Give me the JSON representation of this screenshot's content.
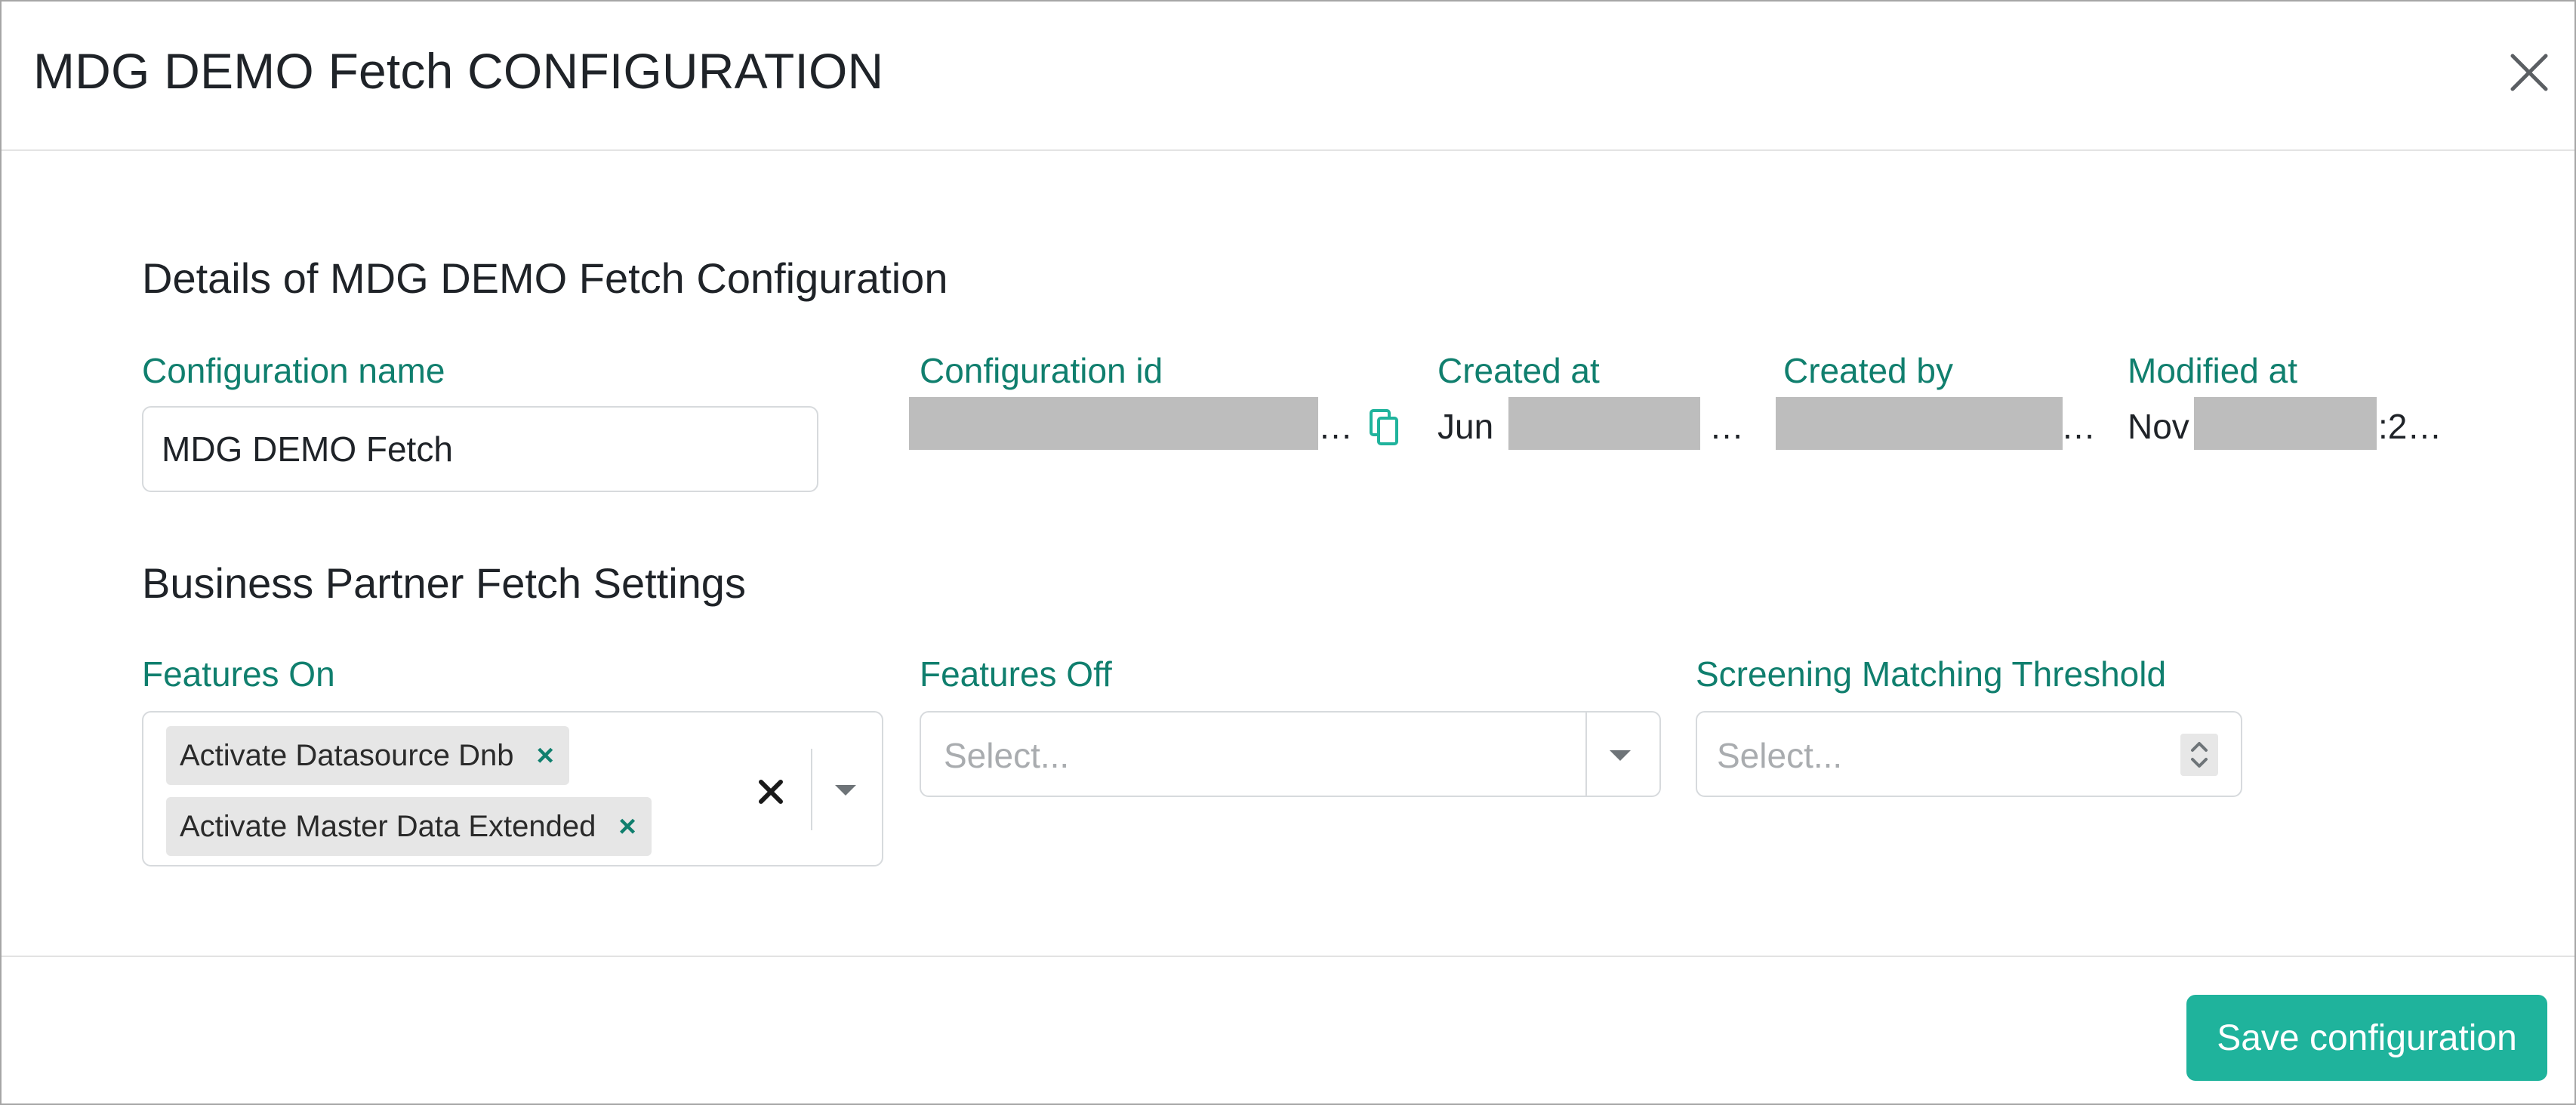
{
  "dialog": {
    "title": "MDG DEMO Fetch CONFIGURATION",
    "close_icon": "close-icon"
  },
  "details": {
    "section_title": "Details of MDG DEMO Fetch Configuration",
    "configuration_name": {
      "label": "Configuration name",
      "value": "MDG DEMO Fetch"
    },
    "configuration_id": {
      "label": "Configuration id",
      "value_visible": "",
      "ellipsis": "…",
      "copy_icon": "copy-icon"
    },
    "created_at": {
      "label": "Created at",
      "value_visible": "Jun",
      "ellipsis": "…"
    },
    "created_by": {
      "label": "Created by",
      "value_visible": "",
      "ellipsis": "…"
    },
    "modified_at": {
      "label": "Modified at",
      "value_prefix": "Nov",
      "value_suffix": ":2…"
    }
  },
  "fetch_settings": {
    "section_title": "Business Partner Fetch Settings",
    "features_on": {
      "label": "Features On",
      "selected": [
        "Activate Datasource Dnb",
        "Activate Master Data Extended"
      ],
      "chip_remove": "×",
      "clear_icon": "clear-all-icon",
      "dropdown_icon": "chevron-down-icon"
    },
    "features_off": {
      "label": "Features Off",
      "placeholder": "Select...",
      "dropdown_icon": "chevron-down-icon"
    },
    "screening_matching_threshold": {
      "label": "Screening Matching Threshold",
      "placeholder": "Select...",
      "spinner_icon": "stepper-icon"
    }
  },
  "footer": {
    "save_label": "Save configuration"
  },
  "colors": {
    "accent": "#1fb39c",
    "label": "#107f6e",
    "border": "#d7dadd"
  }
}
